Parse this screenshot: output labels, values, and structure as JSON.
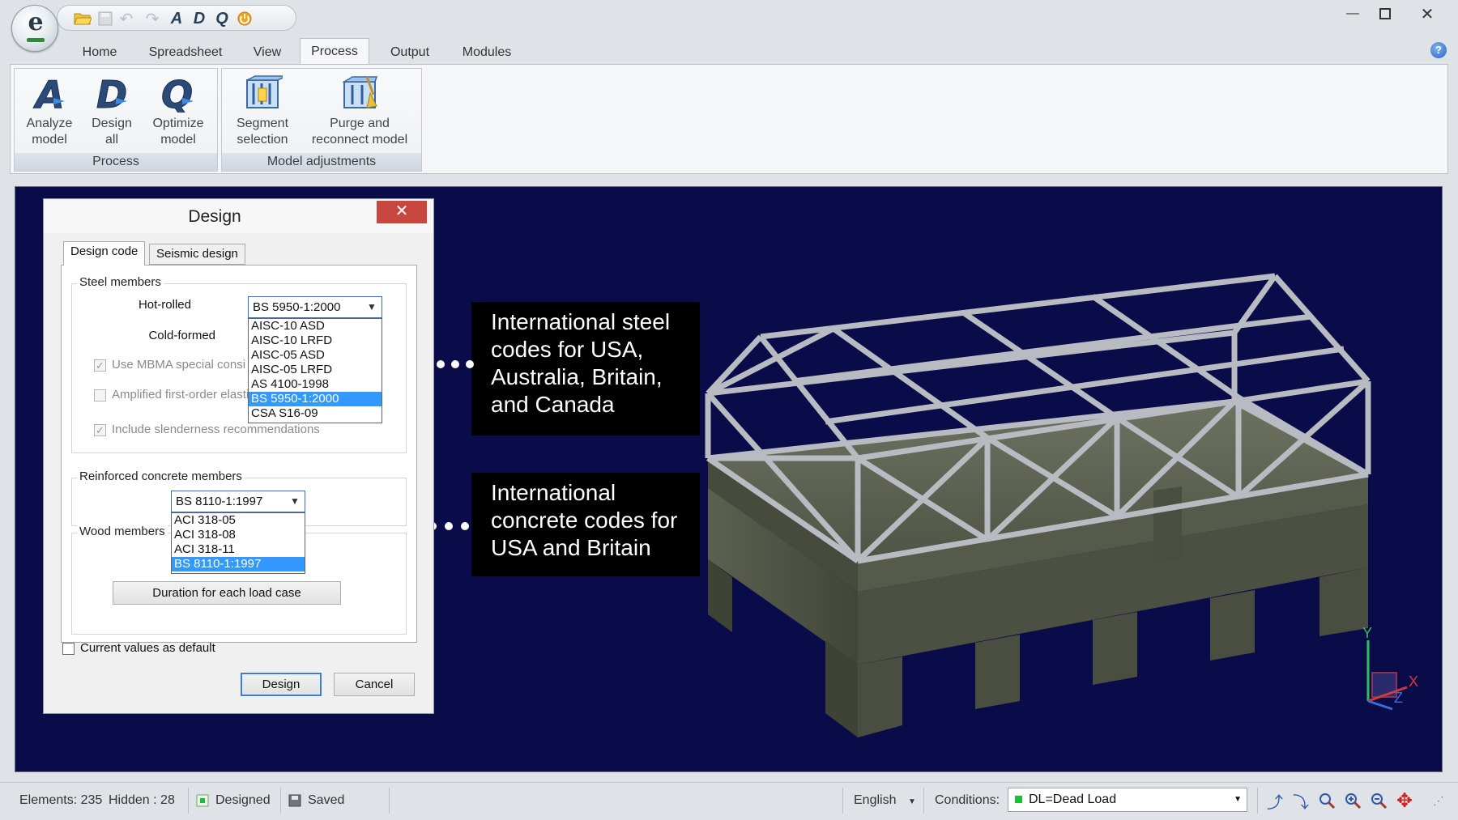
{
  "app": {
    "orb_letter": "e",
    "quick_access": [
      "open",
      "save",
      "undo",
      "redo",
      "A",
      "D",
      "Q",
      "power"
    ]
  },
  "ribbon": {
    "tabs": [
      {
        "label": "Home",
        "active": false
      },
      {
        "label": "Spreadsheet",
        "active": false
      },
      {
        "label": "View",
        "active": false
      },
      {
        "label": "Process",
        "active": true
      },
      {
        "label": "Output",
        "active": false
      },
      {
        "label": "Modules",
        "active": false
      }
    ],
    "groups": [
      {
        "label": "Process",
        "buttons": [
          {
            "line1": "Analyze",
            "line2": "model",
            "icon": "analyze-icon"
          },
          {
            "line1": "Design",
            "line2": "all",
            "icon": "design-icon"
          },
          {
            "line1": "Optimize",
            "line2": "model",
            "icon": "optimize-icon"
          }
        ]
      },
      {
        "label": "Model adjustments",
        "buttons": [
          {
            "line1": "Segment",
            "line2": "selection",
            "icon": "segment-icon"
          },
          {
            "line1": "Purge and",
            "line2": "reconnect model",
            "icon": "purge-icon"
          }
        ]
      }
    ]
  },
  "dialog": {
    "title": "Design",
    "help": "?",
    "close": "✕",
    "tabs": [
      {
        "label": "Design code",
        "active": true
      },
      {
        "label": "Seismic design",
        "active": false
      }
    ],
    "steel": {
      "legend": "Steel members",
      "hot_rolled_label": "Hot-rolled",
      "hot_rolled_value": "BS 5950-1:2000",
      "cold_formed_label": "Cold-formed",
      "options": [
        "AISC-10 ASD",
        "AISC-10 LRFD",
        "AISC-05 ASD",
        "AISC-05 LRFD",
        "AS 4100-1998",
        "BS 5950-1:2000",
        "CSA S16-09"
      ],
      "selected_index": 5,
      "use_mbma": "Use MBMA special consi",
      "amplified": "Amplified first-order elastic",
      "slenderness": "Include slenderness recommendations"
    },
    "concrete": {
      "legend": "Reinforced concrete members",
      "value": "BS 8110-1:1997",
      "options": [
        "ACI 318-05",
        "ACI 318-08",
        "ACI 318-11",
        "BS 8110-1:1997"
      ],
      "selected_index": 3
    },
    "wood": {
      "legend": "Wood members",
      "duration_button": "Duration for each load case"
    },
    "default_checkbox": "Current values as default",
    "design_button": "Design",
    "cancel_button": "Cancel"
  },
  "callouts": {
    "steel": [
      "International steel",
      "codes for USA,",
      "Australia, Britain,",
      "and Canada"
    ],
    "concrete": [
      "International",
      "concrete codes for",
      "USA and Britain"
    ]
  },
  "axes": {
    "y": "Y",
    "x": "X",
    "z": "Z"
  },
  "status": {
    "elements": "Elements: 235",
    "hidden": "Hidden :  28",
    "designed": "Designed",
    "saved": "Saved",
    "language": "English",
    "conditions_label": "Conditions:",
    "condition_value": "DL=Dead Load"
  },
  "colors": {
    "viewport_bg": "#0a0c4a",
    "callout_bg": "#000000",
    "list_selection": "#3399ff",
    "close_button": "#c7463d",
    "condition_green": "#18c036"
  }
}
